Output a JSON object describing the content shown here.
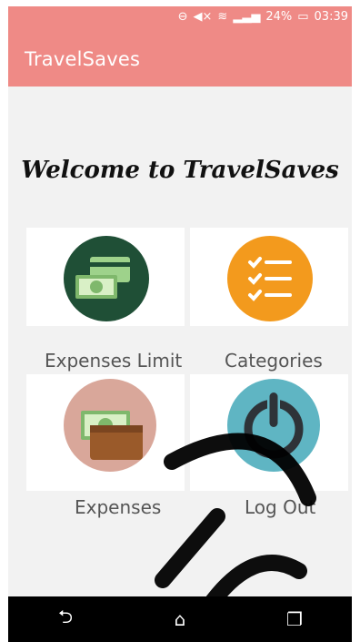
{
  "status_bar": {
    "battery_percent": "24%",
    "time": "03:39"
  },
  "app_bar": {
    "title": "TravelSaves"
  },
  "main": {
    "welcome": "Welcome to TravelSaves",
    "tiles": [
      {
        "label": "Expenses Limit",
        "icon": "money-cards-icon"
      },
      {
        "label": "Categories",
        "icon": "checklist-icon"
      },
      {
        "label": "Expenses",
        "icon": "wallet-icon"
      },
      {
        "label": "Log Out",
        "icon": "power-icon"
      }
    ]
  },
  "colors": {
    "accent": "#ef8a86",
    "expenses_limit": "#1f4f36",
    "categories": "#f39a1d",
    "expenses": "#d9a79a",
    "logout": "#5fb5c3"
  }
}
